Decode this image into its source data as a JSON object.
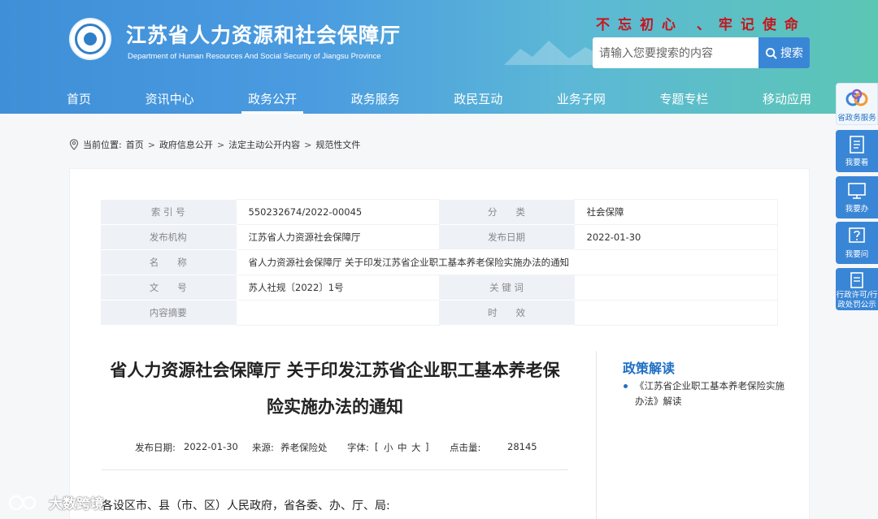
{
  "header": {
    "title": "江苏省人力资源和社会保障厅",
    "subtitle": "Department of Human Resources And Social Security of Jiangsu Province",
    "slogan": "不忘初心 、牢记使命",
    "search": {
      "placeholder": "请输入您要搜索的内容",
      "button_label": "搜索"
    },
    "colors": {
      "header_start": "#3f8fd8",
      "header_end": "#5cc6b4",
      "slogan": "#c8141c"
    }
  },
  "nav": {
    "items": [
      {
        "label": "首页"
      },
      {
        "label": "资讯中心"
      },
      {
        "label": "政务公开",
        "active": true
      },
      {
        "label": "政务服务"
      },
      {
        "label": "政民互动"
      },
      {
        "label": "业务子网"
      },
      {
        "label": "专题专栏"
      },
      {
        "label": "移动应用"
      }
    ]
  },
  "breadcrumb": {
    "prefix": "当前位置:",
    "items": [
      "首页",
      "政府信息公开",
      "法定主动公开内容",
      "规范性文件"
    ],
    "separator": ">"
  },
  "meta": {
    "index_label": "索 引 号",
    "index_value": "550232674/2022-00045",
    "category_label": "分　　类",
    "category_value": "社会保障",
    "publisher_label": "发布机构",
    "publisher_value": "江苏省人力资源社会保障厅",
    "date_label": "发布日期",
    "date_value": "2022-01-30",
    "name_label": "名　　称",
    "name_value": "省人力资源社会保障厅 关于印发江苏省企业职工基本养老保险实施办法的通知",
    "docno_label": "文　　号",
    "docno_value": "苏人社规〔2022〕1号",
    "keyword_label": "关 键 词",
    "keyword_value": "",
    "summary_label": "内容摘要",
    "summary_value": "",
    "validity_label": "时　　效",
    "validity_value": ""
  },
  "article": {
    "title": "省人力资源社会保障厅 关于印发江苏省企业职工基本养老保险实施办法的通知",
    "date_label": "发布日期:",
    "date": "2022-01-30",
    "source_label": "来源:",
    "source": "养老保险处",
    "font_label": "字体:",
    "font_open": "[",
    "font_small": "小",
    "font_medium": "中",
    "font_large": "大",
    "font_close": "]",
    "hits_label": "点击量:",
    "hits": "28145",
    "body_first_line": "各设区市、县（市、区）人民政府，省各委、办、厅、局:"
  },
  "interpretation": {
    "title": "政策解读",
    "items": [
      "《江苏省企业职工基本养老保险实施办法》解读"
    ]
  },
  "float_bar": {
    "items": [
      {
        "label": "省政务服务",
        "icon": "service-logo-icon"
      },
      {
        "label": "我要看",
        "icon": "book-icon"
      },
      {
        "label": "我要办",
        "icon": "monitor-icon"
      },
      {
        "label": "我要问",
        "icon": "question-icon"
      },
      {
        "label": "行政许可/行政处罚公示",
        "icon": "clipboard-icon"
      }
    ]
  },
  "watermark": "大数跨境"
}
